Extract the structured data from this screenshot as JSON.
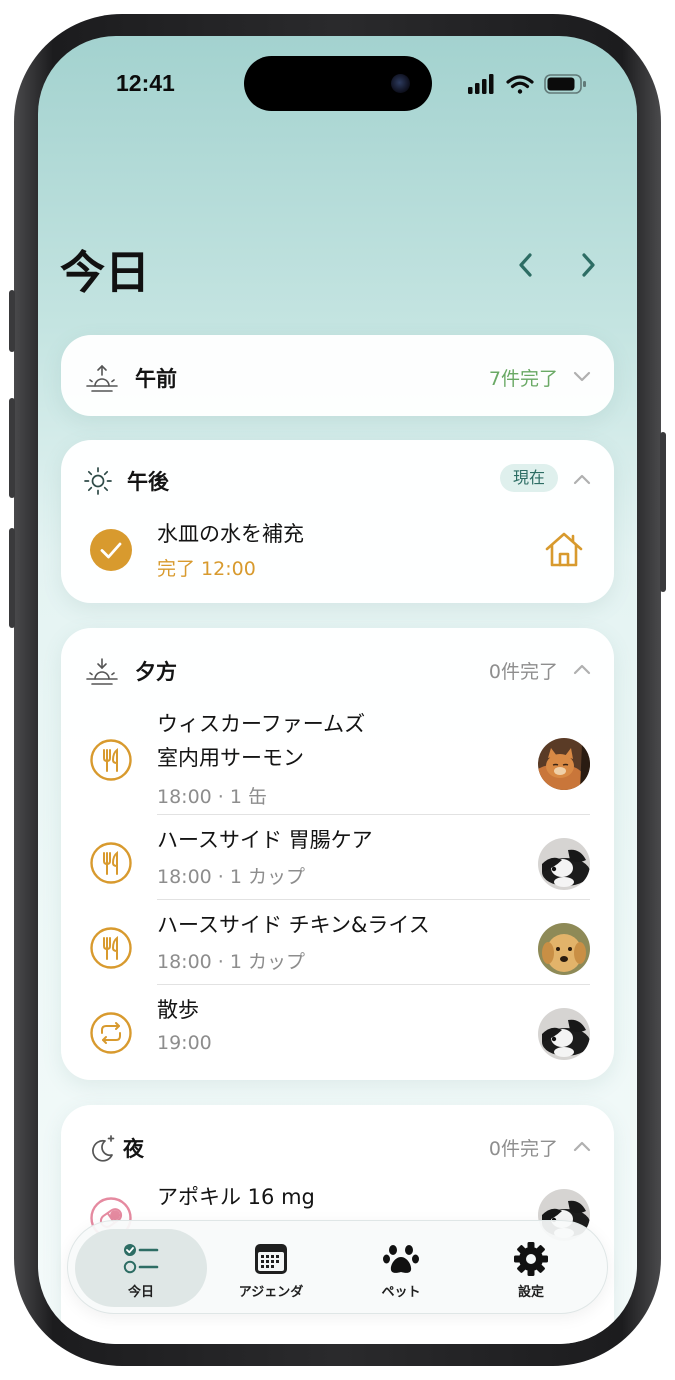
{
  "status_bar": {
    "time": "12:41"
  },
  "header": {
    "title": "今日"
  },
  "colors": {
    "accent_orange": "#d89a2e",
    "accent_green": "#6aa965",
    "teal_dark": "#2d6d64",
    "pink": "#e58aa0"
  },
  "sections": {
    "morning": {
      "title": "午前",
      "count": "7件完了",
      "icon": "sunrise-icon",
      "expanded": false
    },
    "afternoon": {
      "title": "午後",
      "badge": "現在",
      "icon": "sun-icon",
      "expanded": true,
      "tasks": [
        {
          "title": "水皿の水を補充",
          "subtitle": "完了 12:00",
          "icon": "check-circle-icon",
          "trailing": "house-icon"
        }
      ]
    },
    "evening": {
      "title": "夕方",
      "count": "0件完了",
      "icon": "sunset-icon",
      "expanded": true,
      "tasks": [
        {
          "title_line1": "ウィスカーファームズ",
          "title_line2": "室内用サーモン",
          "subtitle": "18:00 · 1 缶",
          "icon": "fork-knife-icon",
          "pet": "orange-cat"
        },
        {
          "title": "ハースサイド 胃腸ケア",
          "subtitle": "18:00 · 1 カップ",
          "icon": "fork-knife-icon",
          "pet": "border-collie"
        },
        {
          "title": "ハースサイド チキン&ライス",
          "subtitle": "18:00 · 1 カップ",
          "icon": "fork-knife-icon",
          "pet": "golden-retriever"
        },
        {
          "title": "散歩",
          "subtitle": "19:00",
          "icon": "repeat-icon",
          "pet": "border-collie"
        }
      ]
    },
    "night": {
      "title": "夜",
      "count": "0件完了",
      "icon": "moon-icon",
      "expanded": true,
      "tasks": [
        {
          "title": "アポキル 16 mg",
          "icon": "pill-icon",
          "pet": "border-collie"
        }
      ]
    }
  },
  "tabbar": {
    "tabs": [
      {
        "label": "今日",
        "icon": "checklist-icon",
        "active": true
      },
      {
        "label": "アジェンダ",
        "icon": "calendar-icon",
        "active": false
      },
      {
        "label": "ペット",
        "icon": "paw-icon",
        "active": false
      },
      {
        "label": "設定",
        "icon": "gear-icon",
        "active": false
      }
    ]
  }
}
